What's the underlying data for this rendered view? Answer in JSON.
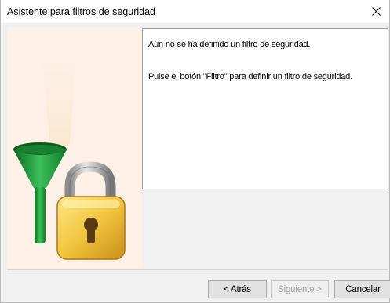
{
  "window": {
    "title": "Asistente para filtros de seguridad"
  },
  "message": {
    "line1": "Aún no se ha definido un filtro de seguridad.",
    "line2": "Pulse el botón \"Filtro\" para definir un filtro de seguridad."
  },
  "buttons": {
    "back_label": "< Atrás",
    "next_label": "Siguiente >",
    "cancel_label": "Cancelar"
  },
  "illustration": {
    "icons": [
      "funnel-icon",
      "padlock-icon"
    ],
    "panel_color": "#fdf0e6",
    "funnel_color": "#1f9a3a",
    "padlock_color": "#f2c53d"
  }
}
